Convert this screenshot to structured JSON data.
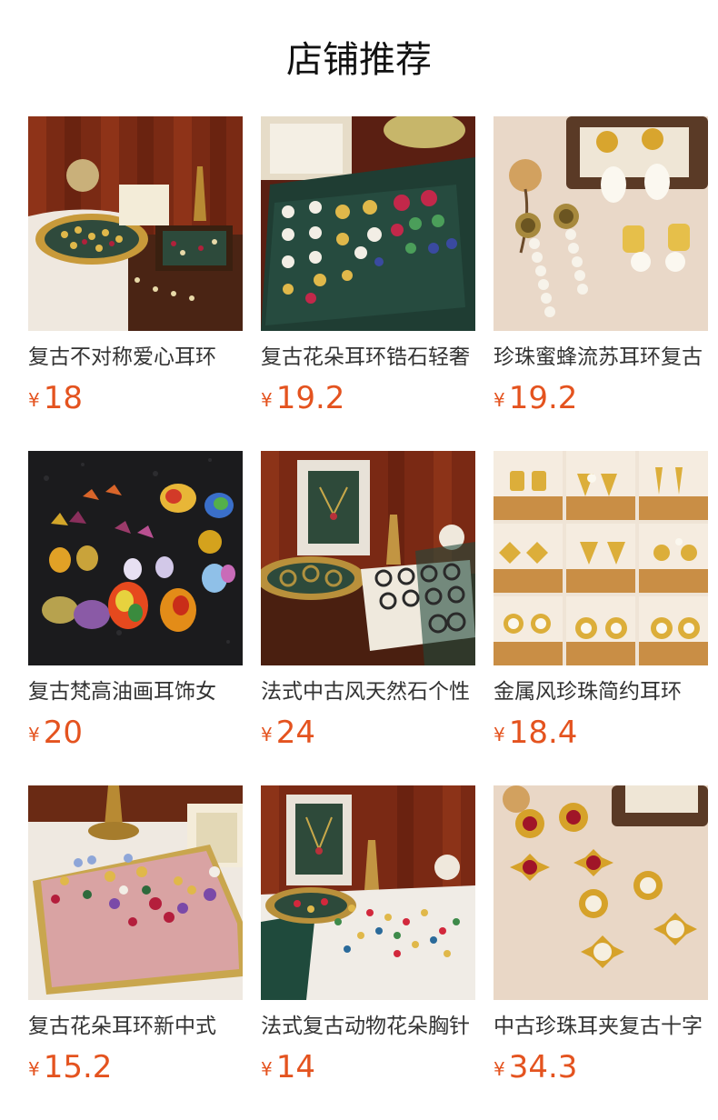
{
  "section_title": "店铺推荐",
  "currency_symbol": "¥",
  "products": [
    {
      "name": "复古不对称爱心耳环",
      "price": "18",
      "photo": "gold-tray-earrings-photo"
    },
    {
      "name": "复古花朵耳环锆石轻奢",
      "price": "19.2",
      "photo": "green-velvet-tray-earrings-photo"
    },
    {
      "name": "珍珠蜜蜂流苏耳环复古",
      "price": "19.2",
      "photo": "pearl-bee-earrings-photo"
    },
    {
      "name": "复古梵高油画耳饰女",
      "price": "20",
      "photo": "oil-painting-earrings-photo"
    },
    {
      "name": "法式中古风天然石个性",
      "price": "24",
      "photo": "natural-stone-earrings-photo"
    },
    {
      "name": "金属风珍珠简约耳环",
      "price": "18.4",
      "photo": "metal-pearl-earrings-grid-photo"
    },
    {
      "name": "复古花朵耳环新中式",
      "price": "15.2",
      "photo": "pink-velvet-tray-earrings-photo"
    },
    {
      "name": "法式复古动物花朵胸针",
      "price": "14",
      "photo": "animal-flower-brooches-photo"
    },
    {
      "name": "中古珍珠耳夹复古十字",
      "price": "34.3",
      "photo": "pearl-cross-clip-earrings-photo"
    }
  ]
}
